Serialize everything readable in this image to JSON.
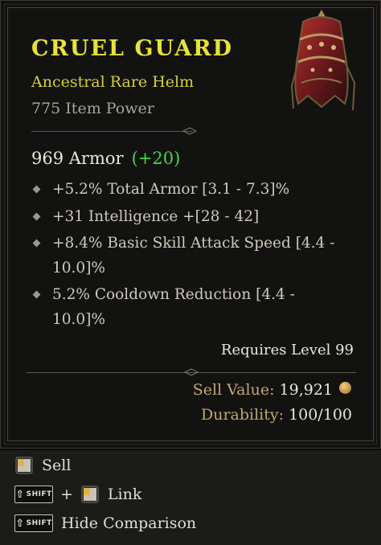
{
  "item": {
    "name": "CRUEL GUARD",
    "type": "Ancestral Rare Helm",
    "item_power": "775 Item Power",
    "armor": "969 Armor",
    "armor_bonus": "(+20)",
    "affixes": [
      {
        "line1": "+5.2% Total Armor [3.1 - 7.3]%",
        "line2": ""
      },
      {
        "line1": "+31 Intelligence +[28 - 42]",
        "line2": ""
      },
      {
        "line1": "+8.4% Basic Skill Attack Speed  [4.4 -",
        "line2": "10.0]%"
      },
      {
        "line1": "5.2% Cooldown Reduction [4.4 -",
        "line2": "10.0]%"
      }
    ],
    "requires": "Requires Level 99",
    "sell_label": "Sell Value:",
    "sell_value": "19,921",
    "durability_label": "Durability:",
    "durability_value": "100/100"
  },
  "controls": {
    "sell_label": "Sell",
    "shift_key": "SHIFT",
    "plus": "+",
    "link_label": "Link",
    "hide_label": "Hide Comparison"
  },
  "colors": {
    "title": "#e8e23a",
    "rare": "#d6cf3d",
    "bonus": "#45d64a",
    "gold_label": "#c2a671"
  },
  "icons": [
    "helm-icon",
    "mouse-left-icon",
    "shift-key-icon",
    "gold-coin-icon",
    "bullet-diamond-icon"
  ]
}
